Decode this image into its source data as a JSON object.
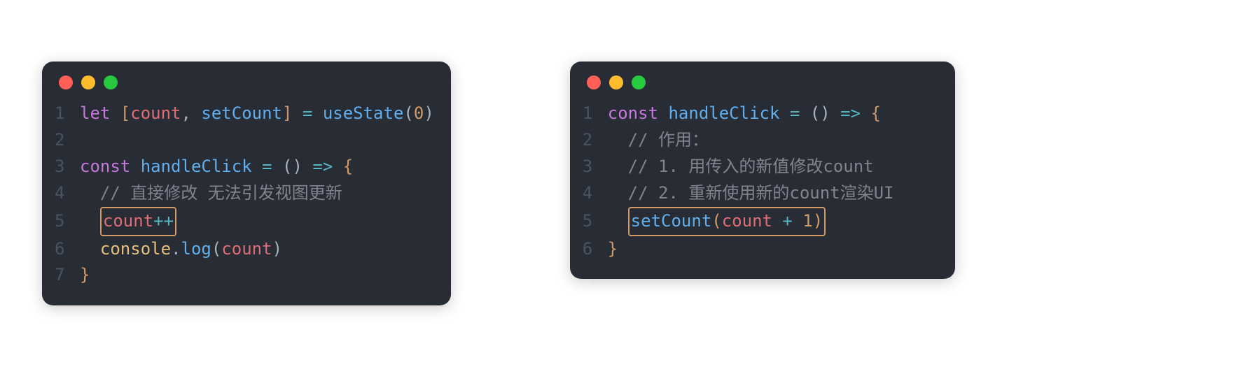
{
  "panels": [
    {
      "lines": [
        {
          "num": "1",
          "tokens": [
            {
              "t": "let ",
              "c": "kw"
            },
            {
              "t": "[",
              "c": "bracket"
            },
            {
              "t": "count",
              "c": "var"
            },
            {
              "t": ", ",
              "c": "punct"
            },
            {
              "t": "setCount",
              "c": "fn"
            },
            {
              "t": "]",
              "c": "bracket"
            },
            {
              "t": " = ",
              "c": "op"
            },
            {
              "t": "useState",
              "c": "fncall"
            },
            {
              "t": "(",
              "c": "punct"
            },
            {
              "t": "0",
              "c": "num"
            },
            {
              "t": ")",
              "c": "punct"
            }
          ]
        },
        {
          "num": "2",
          "tokens": []
        },
        {
          "num": "3",
          "tokens": [
            {
              "t": "const ",
              "c": "kw"
            },
            {
              "t": "handleClick",
              "c": "fn"
            },
            {
              "t": " = ",
              "c": "op"
            },
            {
              "t": "()",
              "c": "punct"
            },
            {
              "t": " => ",
              "c": "op"
            },
            {
              "t": "{",
              "c": "bracket"
            }
          ]
        },
        {
          "num": "4",
          "tokens": [
            {
              "t": "  ",
              "c": "plain"
            },
            {
              "t": "// 直接修改 无法引发视图更新",
              "c": "cmt"
            }
          ]
        },
        {
          "num": "5",
          "highlight": true,
          "indent": "  ",
          "tokens": [
            {
              "t": "count",
              "c": "var"
            },
            {
              "t": "++",
              "c": "op"
            }
          ]
        },
        {
          "num": "6",
          "tokens": [
            {
              "t": "  ",
              "c": "plain"
            },
            {
              "t": "console",
              "c": "obj"
            },
            {
              "t": ".",
              "c": "punct"
            },
            {
              "t": "log",
              "c": "fncall"
            },
            {
              "t": "(",
              "c": "punct"
            },
            {
              "t": "count",
              "c": "var"
            },
            {
              "t": ")",
              "c": "punct"
            }
          ]
        },
        {
          "num": "7",
          "tokens": [
            {
              "t": "}",
              "c": "bracket"
            }
          ]
        }
      ]
    },
    {
      "lines": [
        {
          "num": "1",
          "tokens": [
            {
              "t": "const ",
              "c": "kw"
            },
            {
              "t": "handleClick",
              "c": "fn"
            },
            {
              "t": " = ",
              "c": "op"
            },
            {
              "t": "()",
              "c": "punct"
            },
            {
              "t": " => ",
              "c": "op"
            },
            {
              "t": "{",
              "c": "bracket"
            }
          ]
        },
        {
          "num": "2",
          "tokens": [
            {
              "t": "  ",
              "c": "plain"
            },
            {
              "t": "// 作用：",
              "c": "cmt"
            }
          ]
        },
        {
          "num": "3",
          "tokens": [
            {
              "t": "  ",
              "c": "plain"
            },
            {
              "t": "// 1. 用传入的新值修改count",
              "c": "cmt"
            }
          ]
        },
        {
          "num": "4",
          "tokens": [
            {
              "t": "  ",
              "c": "plain"
            },
            {
              "t": "// 2. 重新使用新的count渲染UI",
              "c": "cmt"
            }
          ]
        },
        {
          "num": "5",
          "highlight": true,
          "indent": "  ",
          "tokens": [
            {
              "t": "setCount",
              "c": "fncall"
            },
            {
              "t": "(",
              "c": "bracket"
            },
            {
              "t": "count",
              "c": "var"
            },
            {
              "t": " + ",
              "c": "op"
            },
            {
              "t": "1",
              "c": "num"
            },
            {
              "t": ")",
              "c": "bracket"
            }
          ]
        },
        {
          "num": "6",
          "tokens": [
            {
              "t": "}",
              "c": "bracket"
            }
          ]
        }
      ]
    }
  ],
  "traffic_colors": {
    "red": "#ff5f56",
    "yellow": "#ffbd2e",
    "green": "#27c93f"
  }
}
